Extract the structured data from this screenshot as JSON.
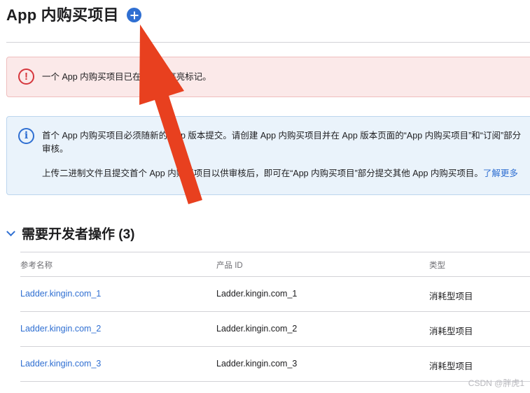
{
  "header": {
    "title": "App 内购买项目",
    "add_icon": "plus-circle-icon"
  },
  "error_banner": {
    "icon": "exclamation-circle-icon",
    "text": "一个 App 内购买项目已在下表中高亮标记。"
  },
  "info_banner": {
    "icon": "info-circle-icon",
    "line1": "首个 App 内购买项目必须随新的 App 版本提交。请创建 App 内购买项目并在 App 版本页面的“App 内购买项目”和“订阅”部分",
    "line2": "审核。",
    "line3": "上传二进制文件且提交首个 App 内购买项目以供审核后，即可在“App 内购买项目”部分提交其他 App 内购买项目。",
    "link": "了解更多"
  },
  "section": {
    "chevron_icon": "chevron-down-icon",
    "title": "需要开发者操作 (3)"
  },
  "table": {
    "columns": [
      "参考名称",
      "产品 ID",
      "类型"
    ],
    "rows": [
      {
        "name": "Ladder.kingin.com_1",
        "product_id": "Ladder.kingin.com_1",
        "type": "消耗型项目"
      },
      {
        "name": "Ladder.kingin.com_2",
        "product_id": "Ladder.kingin.com_2",
        "type": "消耗型项目"
      },
      {
        "name": "Ladder.kingin.com_3",
        "product_id": "Ladder.kingin.com_3",
        "type": "消耗型项目"
      }
    ]
  },
  "watermark": "CSDN @胖虎1",
  "colors": {
    "accent": "#2f6fd2",
    "error": "#d6363c",
    "annotation_arrow": "#e8401f"
  }
}
